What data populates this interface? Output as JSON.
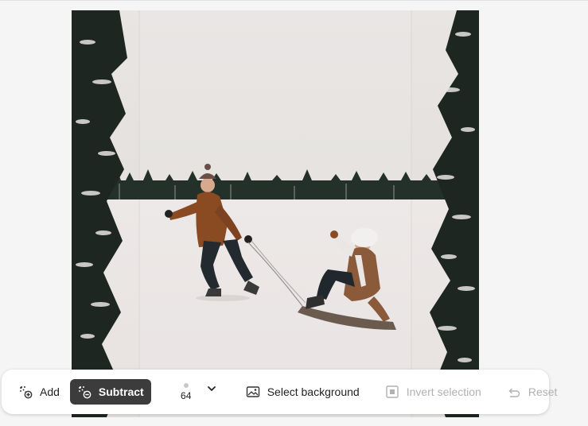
{
  "toolbar": {
    "add_label": "Add",
    "subtract_label": "Subtract",
    "brush_size": "64",
    "select_background_label": "Select background",
    "invert_selection_label": "Invert selection",
    "reset_label": "Reset"
  },
  "colors": {
    "active_button_bg": "#3c3c3c",
    "disabled_text": "#b1b1b1",
    "canvas_bg": "#f5f5f5"
  },
  "icons": {
    "add": "brush-plus-icon",
    "subtract": "brush-minus-icon",
    "brush_dropdown": "chevron-down-icon",
    "select_background": "image-icon",
    "invert_selection": "invert-selection-icon",
    "reset": "undo-icon"
  }
}
